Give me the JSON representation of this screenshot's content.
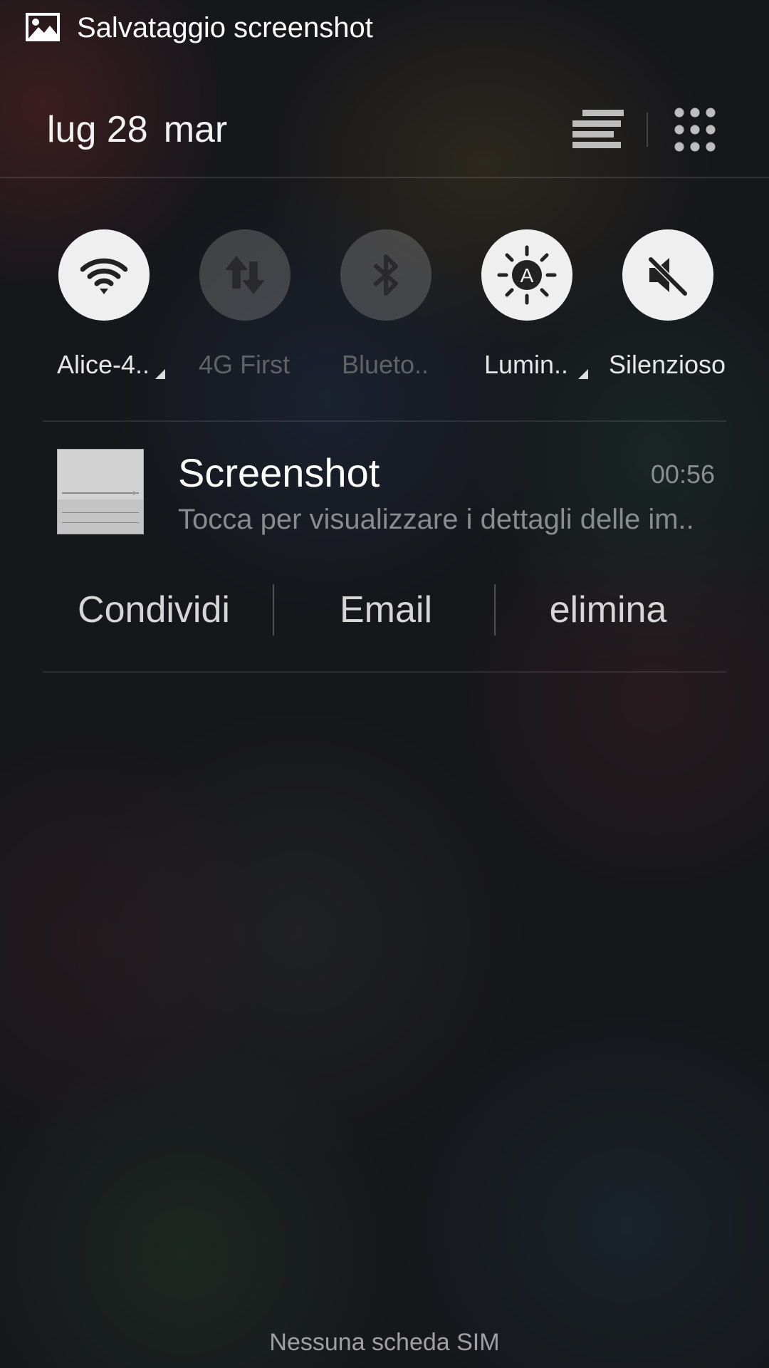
{
  "statusbar": {
    "icon": "image-icon",
    "text": "Salvataggio screenshot"
  },
  "header": {
    "date": "lug 28",
    "weekday": "mar",
    "icons": [
      "notification-list-icon",
      "apps-grid-icon"
    ]
  },
  "toggles": [
    {
      "label": "Alice-4..",
      "icon": "wifi-icon",
      "state": "on",
      "has_menu": true
    },
    {
      "label": "4G First",
      "icon": "mobile-data-icon",
      "state": "off",
      "has_menu": false
    },
    {
      "label": "Blueto..",
      "icon": "bluetooth-icon",
      "state": "off",
      "has_menu": false
    },
    {
      "label": "Lumin..",
      "icon": "auto-brightness-icon",
      "state": "on",
      "has_menu": true
    },
    {
      "label": "Silenzioso",
      "icon": "mute-icon",
      "state": "on",
      "has_menu": false
    }
  ],
  "notification": {
    "title": "Screenshot",
    "time": "00:56",
    "text": "Tocca per visualizzare i dettagli delle im..",
    "actions": [
      "Condividi",
      "Email",
      "elimina"
    ]
  },
  "footer": "Nessuna scheda SIM",
  "colors": {
    "background": "#16171b",
    "toggle_on": "#efefef",
    "toggle_off": "#5a5a5c"
  }
}
